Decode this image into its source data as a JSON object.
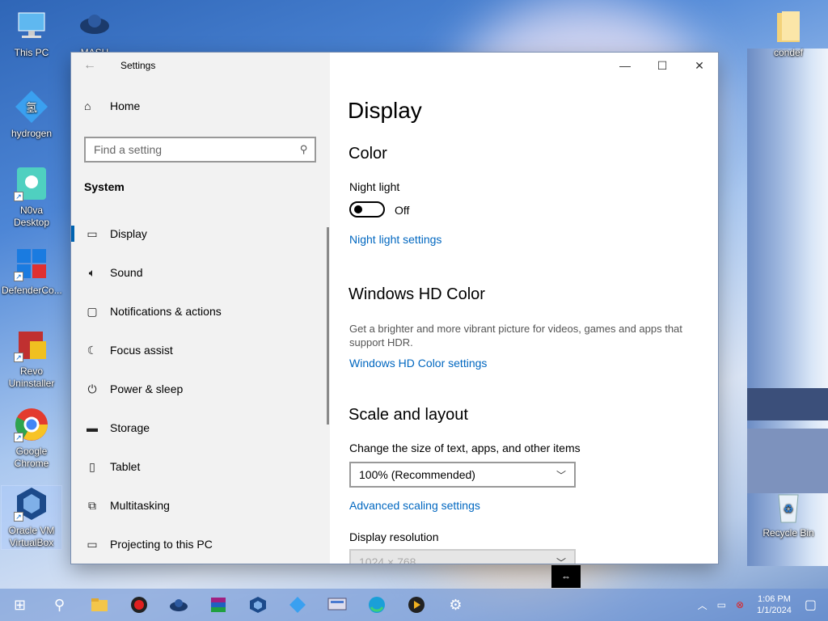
{
  "desktop": {
    "icons_left": [
      {
        "label": "This PC",
        "icon": "this-pc-icon"
      },
      {
        "label": "hydrogen",
        "icon": "hydrogen-icon"
      },
      {
        "label": "N0va Desktop",
        "icon": "nova-desktop-icon"
      },
      {
        "label": "DefenderCo...",
        "icon": "defender-control-icon"
      },
      {
        "label": "Revo Uninstaller",
        "icon": "revo-uninstaller-icon"
      },
      {
        "label": "Google Chrome",
        "icon": "chrome-icon"
      },
      {
        "label": "Oracle VM VirtualBox",
        "icon": "virtualbox-icon"
      }
    ],
    "icon_mash": {
      "label": "MASH",
      "icon": "mash-icon"
    },
    "icons_right": [
      {
        "label": "condef",
        "icon": "folder-icon"
      },
      {
        "label": "Recycle Bin",
        "icon": "recycle-bin-icon"
      }
    ]
  },
  "window": {
    "title": "Settings",
    "controls": {
      "minimize": "—",
      "maximize": "☐",
      "close": "✕"
    },
    "sidebar": {
      "home_label": "Home",
      "search_placeholder": "Find a setting",
      "section": "System",
      "items": [
        {
          "label": "Display",
          "icon": "display-icon",
          "active": true
        },
        {
          "label": "Sound",
          "icon": "sound-icon"
        },
        {
          "label": "Notifications & actions",
          "icon": "notifications-icon"
        },
        {
          "label": "Focus assist",
          "icon": "moon-icon"
        },
        {
          "label": "Power & sleep",
          "icon": "power-icon"
        },
        {
          "label": "Storage",
          "icon": "storage-icon"
        },
        {
          "label": "Tablet",
          "icon": "tablet-icon"
        },
        {
          "label": "Multitasking",
          "icon": "multitasking-icon"
        },
        {
          "label": "Projecting to this PC",
          "icon": "projecting-icon"
        }
      ]
    },
    "main": {
      "page_title": "Display",
      "color_heading": "Color",
      "night_light_label": "Night light",
      "night_light_state": "Off",
      "night_light_link": "Night light settings",
      "hdr_heading": "Windows HD Color",
      "hdr_desc": "Get a brighter and more vibrant picture for videos, games and apps that support HDR.",
      "hdr_link": "Windows HD Color settings",
      "scale_heading": "Scale and layout",
      "scale_label": "Change the size of text, apps, and other items",
      "scale_value": "100% (Recommended)",
      "advanced_scaling_link": "Advanced scaling settings",
      "resolution_label": "Display resolution",
      "resolution_value": "1024 × 768"
    }
  },
  "taskbar": {
    "items": [
      "windows-start-icon",
      "search-icon",
      "file-explorer-icon",
      "record-icon",
      "mash-taskbar-icon",
      "winrar-icon",
      "virtualbox-taskbar-icon",
      "app-icon",
      "remote-desktop-icon",
      "edge-icon",
      "media-player-icon",
      "settings-gear-icon"
    ],
    "clock_time": "1:06 PM",
    "clock_date": "1/1/2024"
  },
  "colors": {
    "accent": "#0067c0",
    "active_bar": "#0063b1"
  }
}
